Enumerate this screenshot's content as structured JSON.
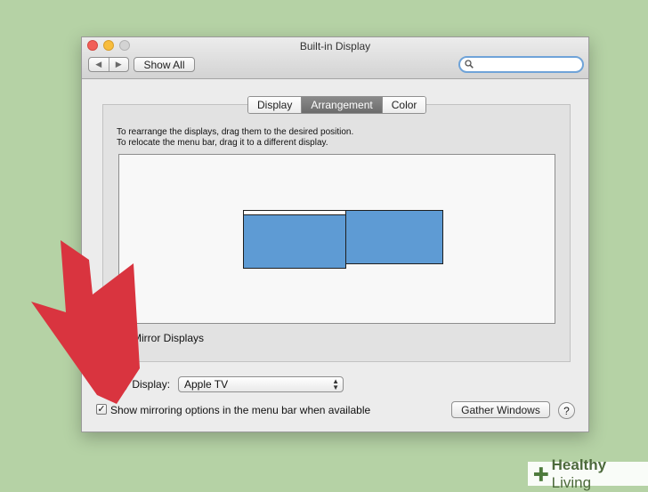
{
  "window": {
    "title": "Built-in Display"
  },
  "toolbar": {
    "back_glyph": "◀",
    "forward_glyph": "▶",
    "show_all_label": "Show All",
    "search_placeholder": ""
  },
  "tabs": [
    {
      "label": "Display",
      "active": false
    },
    {
      "label": "Arrangement",
      "active": true
    },
    {
      "label": "Color",
      "active": false
    }
  ],
  "arrangement": {
    "instruction_line1": "To rearrange the displays, drag them to the desired position.",
    "instruction_line2": "To relocate the menu bar, drag it to a different display.",
    "mirror_label": "Mirror Displays",
    "mirror_checked": false
  },
  "airplay": {
    "label": "AirPlay Display:",
    "selected": "Apple TV"
  },
  "menu_bar_option": {
    "label": "Show mirroring options in the menu bar when available",
    "checked": true,
    "check_glyph": "✓"
  },
  "gather_windows_label": "Gather Windows",
  "help_label": "?",
  "watermark": {
    "bold": "Healthy",
    "regular": " Living"
  },
  "colors": {
    "arrow": "#d9343f",
    "display_fill": "#5e9bd4",
    "background": "#b5d2a5"
  }
}
